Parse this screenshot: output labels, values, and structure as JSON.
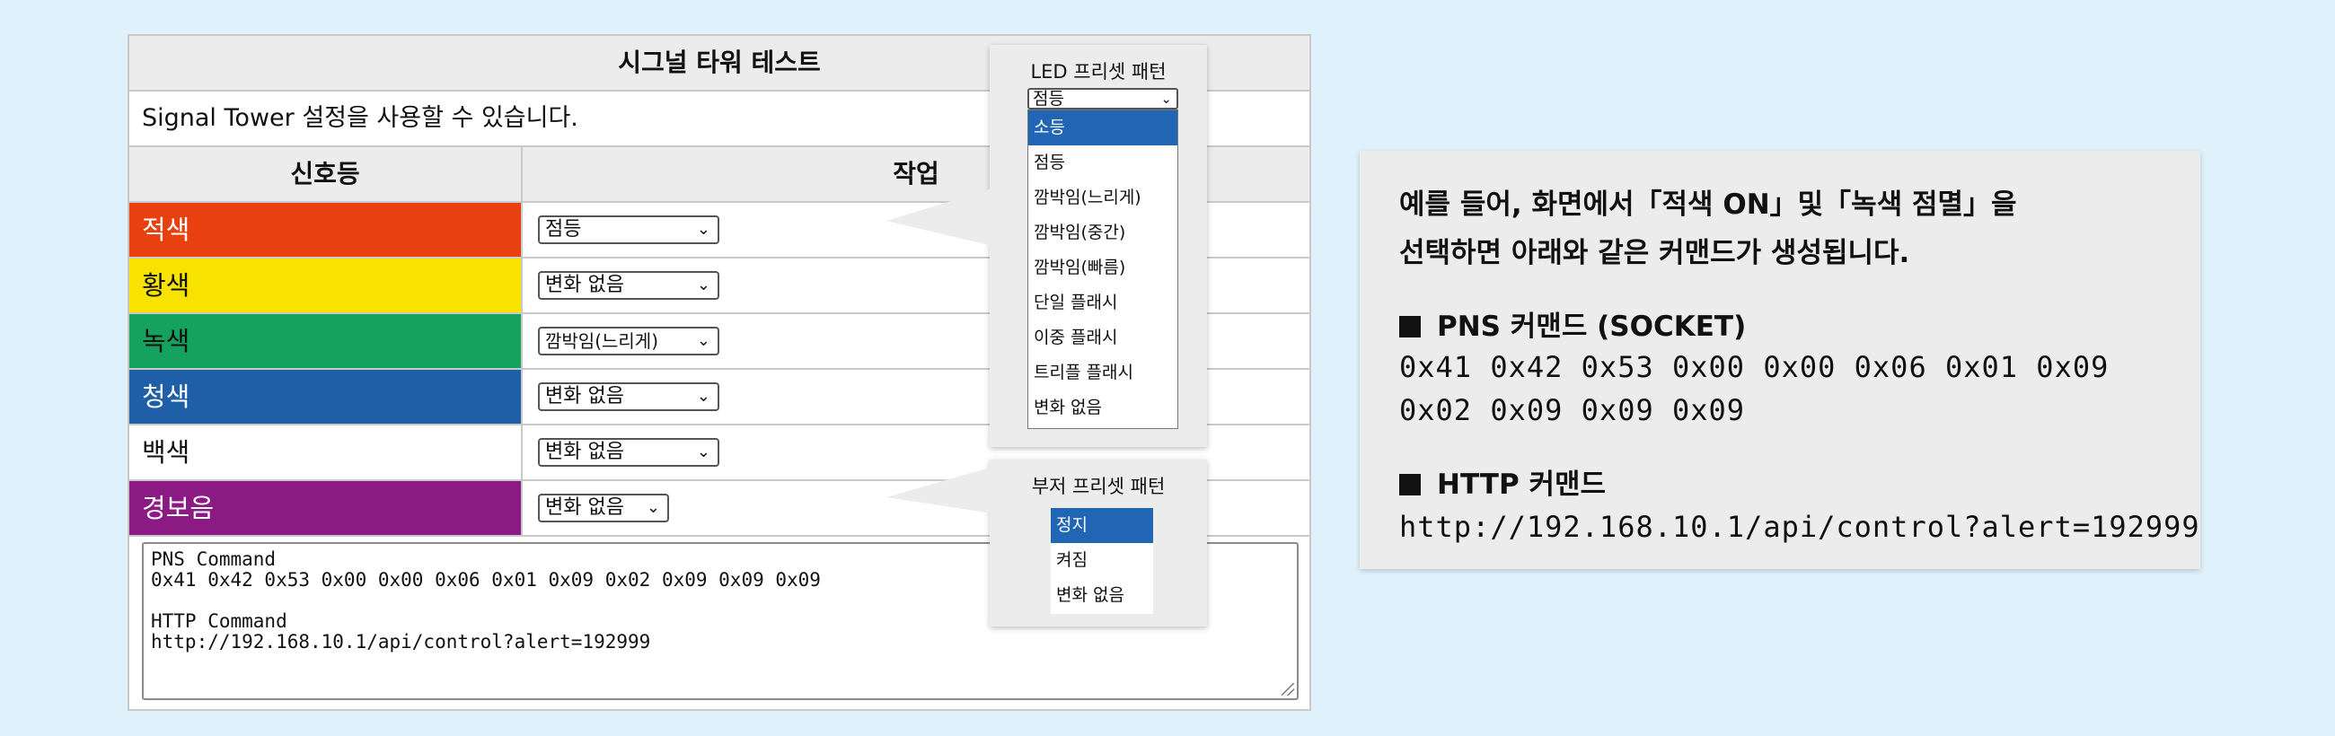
{
  "panel": {
    "title": "시그널 타워 테스트",
    "description": "Signal Tower 설정을 사용할 수 있습니다.",
    "col_signal": "신호등",
    "col_action": "작업"
  },
  "signals": [
    {
      "label": "적색",
      "color": "#e8410f",
      "text_color": "#ffffff",
      "value": "점등"
    },
    {
      "label": "황색",
      "color": "#f7e200",
      "text_color": "#111111",
      "value": "변화 없음"
    },
    {
      "label": "녹색",
      "color": "#15a15e",
      "text_color": "#111111",
      "value": "깜박임(느리게)"
    },
    {
      "label": "청색",
      "color": "#1f5fa8",
      "text_color": "#ffffff",
      "value": "변화 없음"
    },
    {
      "label": "백색",
      "color": "#ffffff",
      "text_color": "#111111",
      "value": "변화 없음"
    },
    {
      "label": "경보음",
      "color": "#8b1a84",
      "text_color": "#ffffff",
      "value": "변화 없음"
    }
  ],
  "console": {
    "lines": [
      "PNS Command",
      "0x41 0x42 0x53 0x00 0x00 0x06 0x01 0x09 0x02 0x09 0x09 0x09",
      "",
      "HTTP Command",
      "http://192.168.10.1/api/control?alert=192999"
    ]
  },
  "led_popup": {
    "title": "LED 프리셋 패턴",
    "selected": "점등",
    "options": [
      "소등",
      "점등",
      "깜박임(느리게)",
      "깜박임(중간)",
      "깜박임(빠름)",
      "단일 플래시",
      "이중 플래시",
      "트리플 플래시",
      "변화 없음"
    ],
    "highlighted": "소등"
  },
  "buzzer_popup": {
    "title": "부저 프리셋 패턴",
    "options": [
      "정지",
      "켜짐",
      "변화 없음"
    ],
    "highlighted": "정지"
  },
  "info": {
    "line1": "예를 들어, 화면에서「적색 ON」및「녹색 점멸」을",
    "line2": "선택하면 아래와 같은 커맨드가 생성됩니다.",
    "pns_heading": "PNS 커맨드 (SOCKET)",
    "pns_line1": "0x41 0x42 0x53 0x00 0x00 0x06 0x01 0x09",
    "pns_line2": "0x02 0x09 0x09 0x09",
    "http_heading": "HTTP 커맨드",
    "http_url": "http://192.168.10.1/api/control?alert=192999"
  },
  "colors": {
    "background": "#dff1fa",
    "highlight": "#2166b5"
  }
}
